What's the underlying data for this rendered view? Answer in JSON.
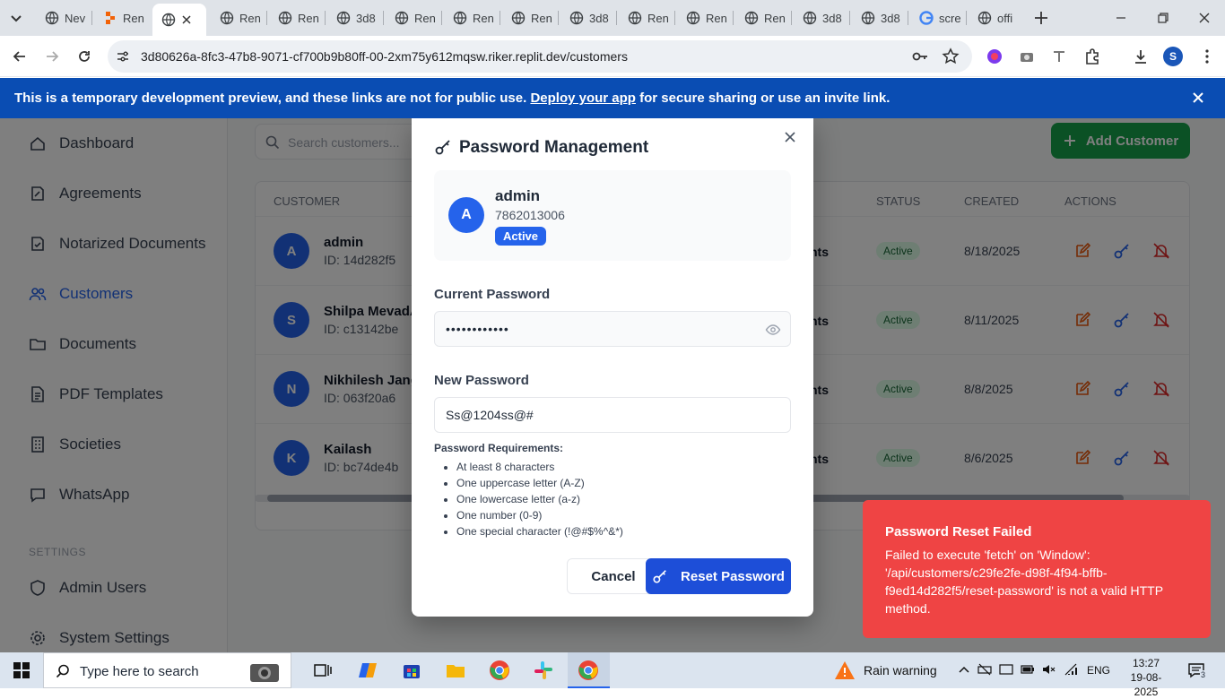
{
  "browser": {
    "tabs": [
      {
        "label": "Nev",
        "icon": "globe-icon"
      },
      {
        "label": "Ren",
        "icon": "replit-icon"
      },
      {
        "label": "",
        "icon": "globe-icon",
        "active": true
      },
      {
        "label": "Ren",
        "icon": "globe-icon"
      },
      {
        "label": "Ren",
        "icon": "globe-icon"
      },
      {
        "label": "3d8",
        "icon": "globe-icon"
      },
      {
        "label": "Ren",
        "icon": "globe-icon"
      },
      {
        "label": "Ren",
        "icon": "globe-icon"
      },
      {
        "label": "Ren",
        "icon": "globe-icon"
      },
      {
        "label": "3d8",
        "icon": "globe-icon"
      },
      {
        "label": "Ren",
        "icon": "globe-icon"
      },
      {
        "label": "Ren",
        "icon": "globe-icon"
      },
      {
        "label": "Ren",
        "icon": "globe-icon"
      },
      {
        "label": "3d8",
        "icon": "globe-icon"
      },
      {
        "label": "3d8",
        "icon": "globe-icon"
      },
      {
        "label": "scre",
        "icon": "google-icon"
      },
      {
        "label": "offi",
        "icon": "globe-icon"
      }
    ],
    "url": "3d80626a-8fc3-47b8-9071-cf700b9b80ff-00-2xm75y612mqsw.riker.replit.dev/customers",
    "profile_initial": "S"
  },
  "banner": {
    "text_before": "This is a temporary development preview, and these links are not for public use. ",
    "link": "Deploy your app",
    "text_after": " for secure sharing or use an invite link."
  },
  "sidebar": {
    "items": [
      {
        "label": "Dashboard",
        "icon": "home-icon"
      },
      {
        "label": "Agreements",
        "icon": "document-edit-icon"
      },
      {
        "label": "Notarized Documents",
        "icon": "document-check-icon"
      },
      {
        "label": "Customers",
        "icon": "users-icon",
        "active": true
      },
      {
        "label": "Documents",
        "icon": "folder-icon"
      },
      {
        "label": "PDF Templates",
        "icon": "file-icon"
      },
      {
        "label": "Societies",
        "icon": "building-icon"
      },
      {
        "label": "WhatsApp",
        "icon": "chat-icon"
      }
    ],
    "settings_label": "SETTINGS",
    "settings_items": [
      {
        "label": "Admin Users",
        "icon": "shield-icon"
      },
      {
        "label": "System Settings",
        "icon": "gear-icon"
      }
    ]
  },
  "main": {
    "search_placeholder": "Search customers...",
    "add_button": "Add Customer",
    "columns": {
      "customer": "CUSTOMER",
      "status": "STATUS",
      "created": "CREATED",
      "actions": "ACTIONS"
    },
    "rows": [
      {
        "initial": "A",
        "name": "admin",
        "id": "ID: 14d282f5",
        "type": "nts",
        "status": "Active",
        "created": "8/18/2025"
      },
      {
        "initial": "S",
        "name": "Shilpa MevadA",
        "id": "ID: c13142be",
        "type": "nts",
        "status": "Active",
        "created": "8/11/2025"
      },
      {
        "initial": "N",
        "name": "Nikhilesh Jangi",
        "id": "ID: 063f20a6",
        "type": "nts",
        "status": "Active",
        "created": "8/8/2025"
      },
      {
        "initial": "K",
        "name": "Kailash",
        "id": "ID: bc74de4b",
        "type": "nts",
        "status": "Active",
        "created": "8/6/2025"
      }
    ]
  },
  "modal": {
    "title": "Password Management",
    "user": {
      "initial": "A",
      "name": "admin",
      "phone": "7862013006",
      "status": "Active"
    },
    "current_label": "Current Password",
    "current_value": "••••••••••••",
    "new_label": "New Password",
    "new_value": "Ss@1204ss@#",
    "requirements_title": "Password Requirements:",
    "requirements": [
      "At least 8 characters",
      "One uppercase letter (A-Z)",
      "One lowercase letter (a-z)",
      "One number (0-9)",
      "One special character (!@#$%^&*)"
    ],
    "cancel": "Cancel",
    "reset": "Reset Password"
  },
  "toast": {
    "title": "Password Reset Failed",
    "message": "Failed to execute 'fetch' on 'Window': '/api/customers/c29fe2fe-d98f-4f94-bffb-f9ed14d282f5/reset-password' is not a valid HTTP method."
  },
  "taskbar": {
    "search_placeholder": "Type here to search",
    "weather": "Rain warning",
    "language": "ENG",
    "time": "13:27",
    "date": "19-08-2025",
    "notification_count": "3"
  },
  "colors": {
    "banner": "#0a4db3",
    "primary": "#2563eb",
    "success": "#16a34a",
    "toast": "#ef4444"
  }
}
